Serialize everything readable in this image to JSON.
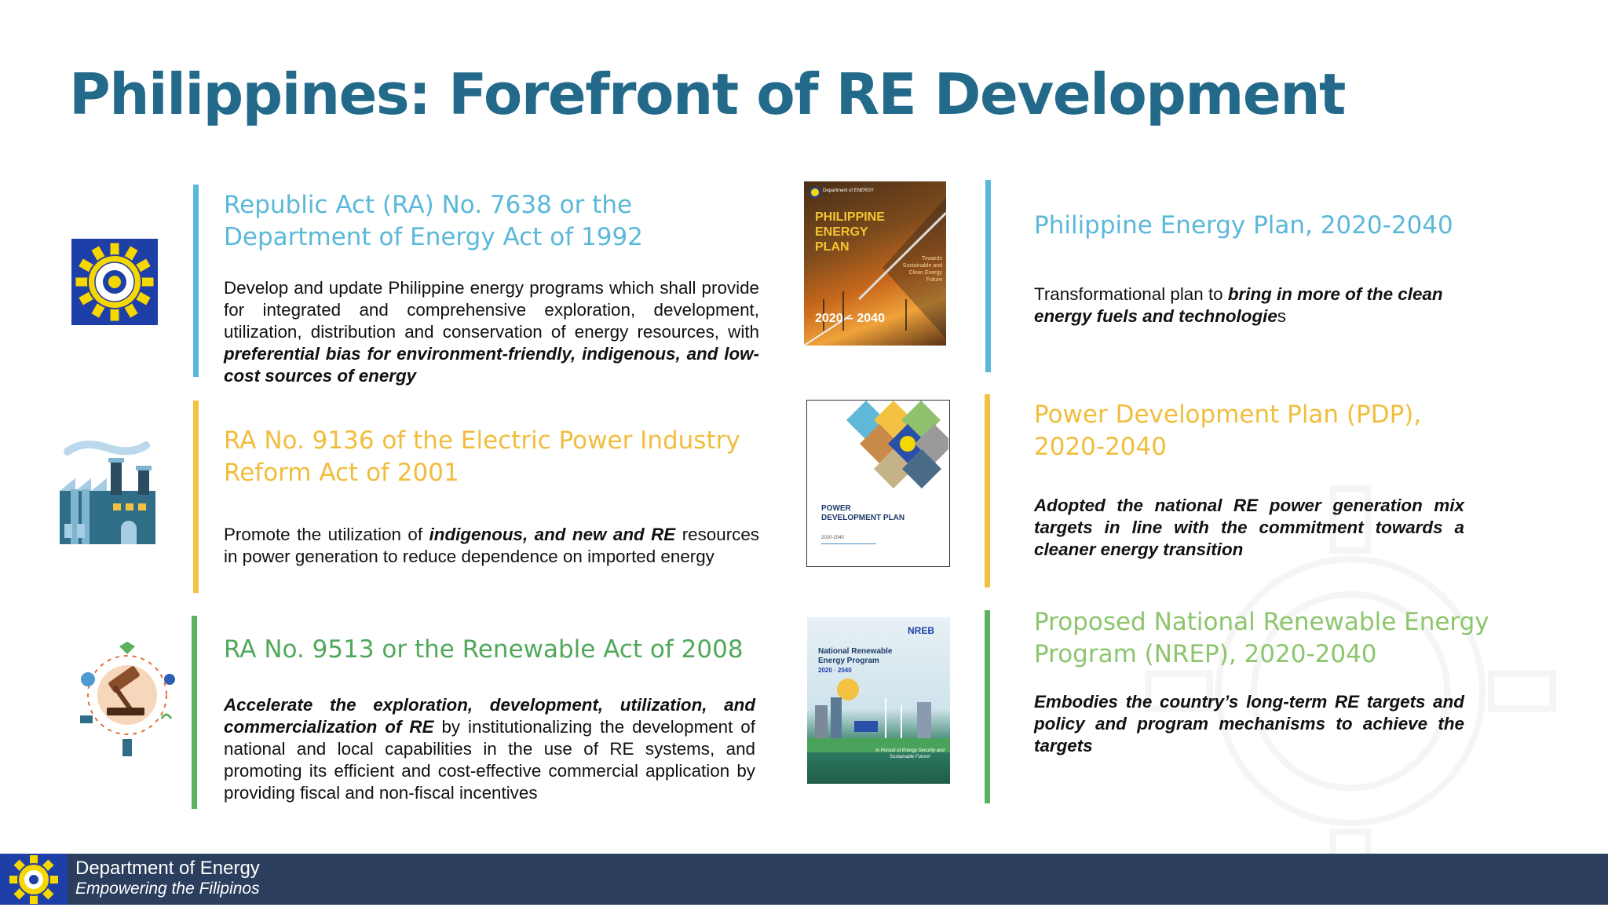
{
  "title": "Philippines: Forefront of RE Development",
  "laws": [
    {
      "heading": "Republic Act (RA) No. 7638 or the Department of Energy Act of 1992",
      "body_plain": "Develop and update Philippine energy programs which shall provide for integrated and comprehensive exploration, development, utilization, distribution and conservation of energy resources, with ",
      "body_emph": "preferential bias for environment-friendly, indigenous, and low-cost sources of energy",
      "icon": "doe-seal-icon"
    },
    {
      "heading": "RA No. 9136 of the Electric Power Industry Reform Act of 2001",
      "body_plain1": "Promote the utilization of ",
      "body_emph": "indigenous, and new and RE",
      "body_plain2": " resources in power generation to reduce dependence on imported energy",
      "icon": "factory-icon"
    },
    {
      "heading": "RA No. 9513 or the Renewable Act of 2008",
      "body_emph": "Accelerate the exploration, development, utilization, and commercialization of RE",
      "body_plain": " by institutionalizing the development of national and local capabilities in the use of RE systems, and promoting its efficient and cost-effective commercial application by providing fiscal and non-fiscal incentives",
      "icon": "gavel-icon"
    }
  ],
  "plans": [
    {
      "heading": "Philippine Energy Plan, 2020-2040",
      "body_plain1": "Transformational plan to ",
      "body_emph": "bring in more of the clean energy fuels and technologie",
      "body_plain2": "s",
      "cover": {
        "org": "Department of ENERGY",
        "title": "PHILIPPINE ENERGY PLAN",
        "subtitle": "Towards Sustainable and Clean Energy Future",
        "years": "2020 – 2040"
      }
    },
    {
      "heading": "Power Development Plan (PDP), 2020-2040",
      "body_emph": "Adopted the national RE power generation mix targets in line with the commitment towards a cleaner energy transition",
      "cover": {
        "title": "POWER DEVELOPMENT PLAN",
        "years": "2020-2040"
      }
    },
    {
      "heading": "Proposed National Renewable Energy Program (NREP), 2020-2040",
      "body_emph": "Embodies the country’s long-term RE targets and policy and program mechanisms to achieve the targets",
      "cover": {
        "brand": "NREB",
        "title": "National Renewable Energy Program",
        "years": "2020 · 2040",
        "tagline": "In Pursuit of Energy Security and Sustainable Future!"
      }
    }
  ],
  "footer": {
    "org": "Department of Energy",
    "tagline": "Empowering the Filipinos"
  },
  "colors": {
    "title": "#236a8a",
    "blue": "#5bb8d9",
    "yellow": "#f3c242",
    "green": "#5bb25c",
    "footer": "#2c3e5e"
  }
}
